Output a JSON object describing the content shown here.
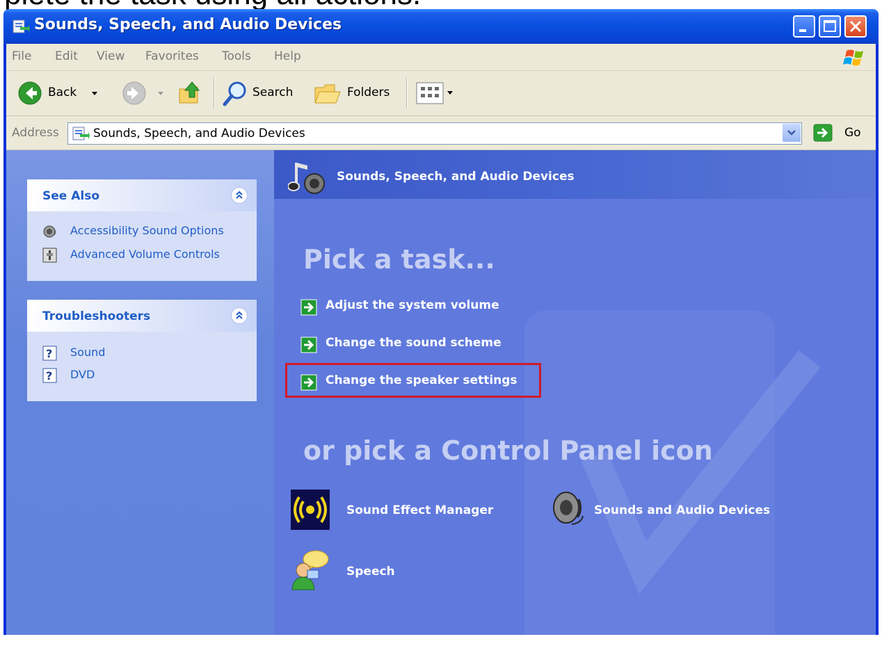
{
  "caption": "plete the task using all actions.",
  "window": {
    "title": "Sounds, Speech, and Audio Devices"
  },
  "menu": {
    "items": [
      "File",
      "Edit",
      "View",
      "Favorites",
      "Tools",
      "Help"
    ]
  },
  "toolbar": {
    "back_label": "Back",
    "search_label": "Search",
    "folders_label": "Folders"
  },
  "address": {
    "label": "Address",
    "value": "Sounds, Speech, and Audio Devices",
    "go_label": "Go"
  },
  "see_also": {
    "title": "See Also",
    "items": [
      {
        "label": "Accessibility Sound Options",
        "icon": "speaker-icon"
      },
      {
        "label": "Advanced Volume Controls",
        "icon": "volume-control-icon"
      }
    ]
  },
  "troubleshooters": {
    "title": "Troubleshooters",
    "items": [
      {
        "label": "Sound",
        "icon": "help-icon"
      },
      {
        "label": "DVD",
        "icon": "help-icon"
      }
    ]
  },
  "category": {
    "title": "Sounds, Speech, and Audio Devices",
    "pick_task": "Pick a task...",
    "tasks": [
      "Adjust the system volume",
      "Change the sound scheme",
      "Change the speaker settings"
    ],
    "pick_icon": "or pick a Control Panel icon",
    "icons": [
      {
        "label": "Sound Effect Manager",
        "icon": "sound-effect-icon"
      },
      {
        "label": "Sounds and Audio Devices",
        "icon": "speaker-icon"
      },
      {
        "label": "Speech",
        "icon": "speech-icon"
      }
    ]
  },
  "colors": {
    "titlebar": "#0a50e0",
    "left_pane": "#6384dc",
    "right_pane": "#6079dd",
    "link": "#215dc6",
    "highlight": "#d11a2a"
  }
}
